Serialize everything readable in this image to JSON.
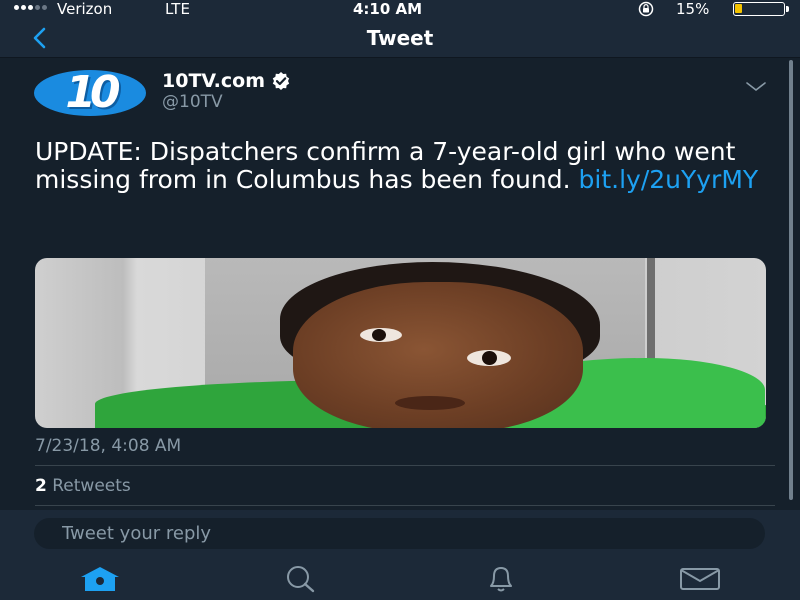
{
  "status_bar": {
    "carrier": "Verizon",
    "network": "LTE",
    "time": "4:10 AM",
    "battery_percent": "15%",
    "battery_level": 0.15,
    "battery_color": "#f5c400"
  },
  "nav": {
    "title": "Tweet",
    "back_icon": "chevron-left-icon"
  },
  "tweet": {
    "display_name": "10TV.com",
    "handle": "@10TV",
    "avatar_text": "10",
    "verified_icon": "verified-badge-icon",
    "text": "UPDATE:  Dispatchers confirm a 7-year-old girl who went missing from in Columbus has been found.  ",
    "link": "bit.ly/2uYyrMY",
    "timestamp": "7/23/18, 4:08 AM",
    "retweet_count": "2",
    "retweet_label": " Retweets"
  },
  "reply": {
    "placeholder": "Tweet your reply"
  },
  "tabs": [
    {
      "icon": "home-icon",
      "active": true
    },
    {
      "icon": "search-icon",
      "active": false
    },
    {
      "icon": "notifications-bell-icon",
      "active": false
    },
    {
      "icon": "messages-envelope-icon",
      "active": false
    }
  ],
  "colors": {
    "background": "#15202b",
    "bar": "#1c2938",
    "accent": "#1da1f2",
    "muted": "#8899a6"
  }
}
